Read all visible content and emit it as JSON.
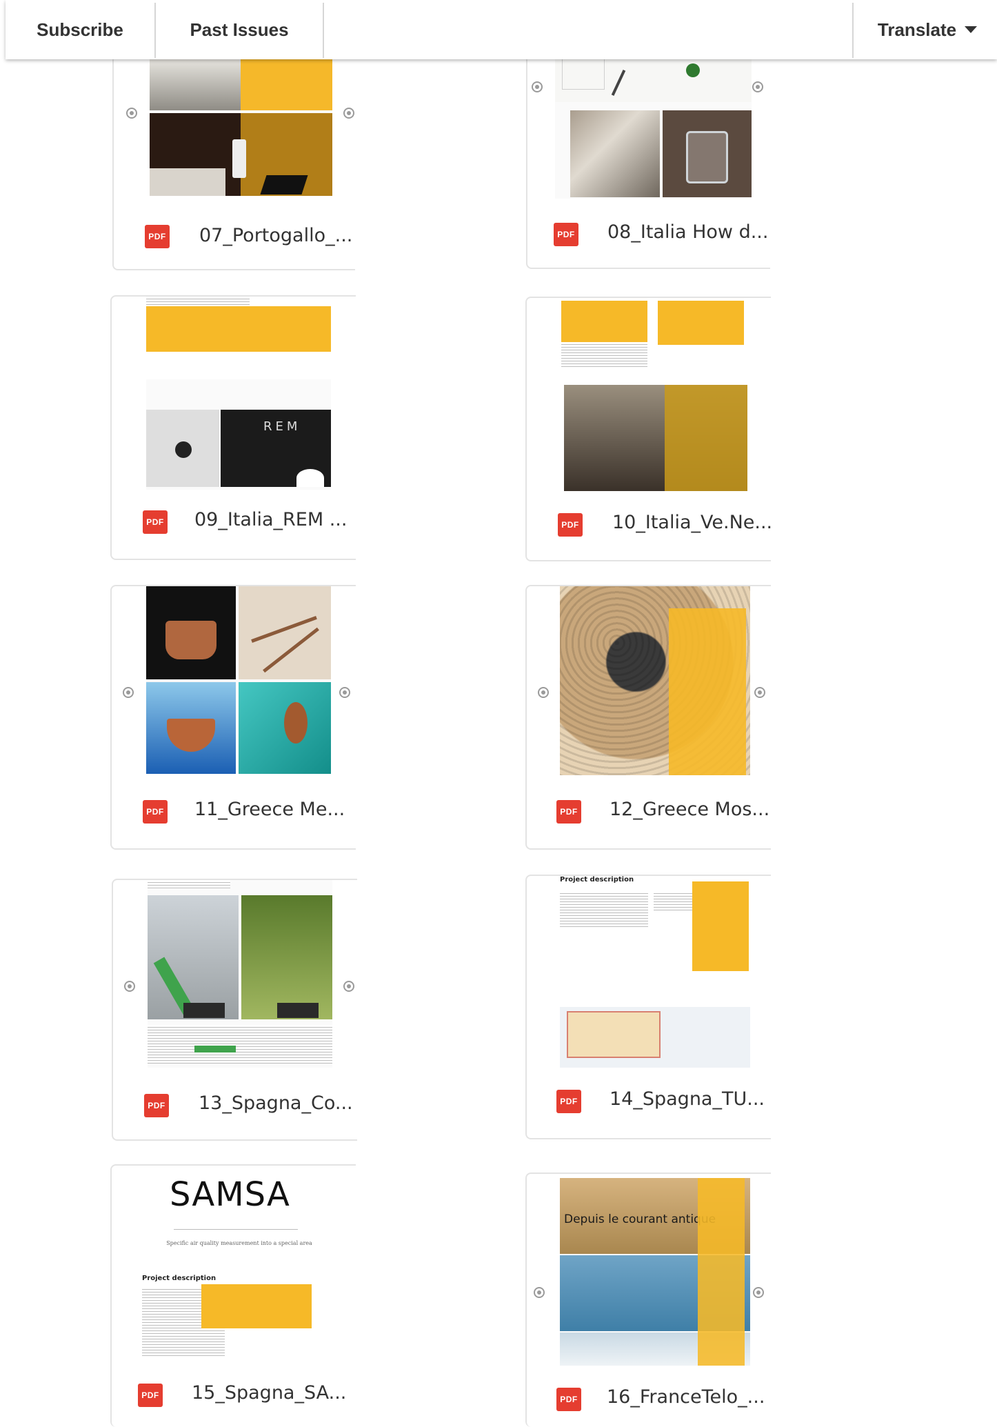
{
  "topbar": {
    "subscribe_label": "Subscribe",
    "past_issues_label": "Past Issues",
    "translate_label": "Translate"
  },
  "accent_color": "#f6b928",
  "pdf_color": "#e53d30",
  "files": [
    {
      "name": "07_Portogallo_..."
    },
    {
      "name": "08_Italia How d..."
    },
    {
      "name": "09_Italia_REM ..."
    },
    {
      "name": "10_Italia_Ve.Ne..."
    },
    {
      "name": "11_Greece Me..."
    },
    {
      "name": "12_Greece Mos..."
    },
    {
      "name": "13_Spagna_Co..."
    },
    {
      "name": "14_Spagna_TU..."
    },
    {
      "name": "15_Spagna_SA..."
    },
    {
      "name": "16_FranceTelo_..."
    }
  ],
  "pdf_badge_label": "PDF",
  "thumb_texts": {
    "rem_logo": "REM",
    "samsa_title": "SAMSA",
    "samsa_subtitle": "Specific air quality measurement into a special area",
    "samsa_heading": "Project description",
    "spagna_tu_heading": "Project description",
    "france_overlay": "Depuis le courant antique"
  }
}
